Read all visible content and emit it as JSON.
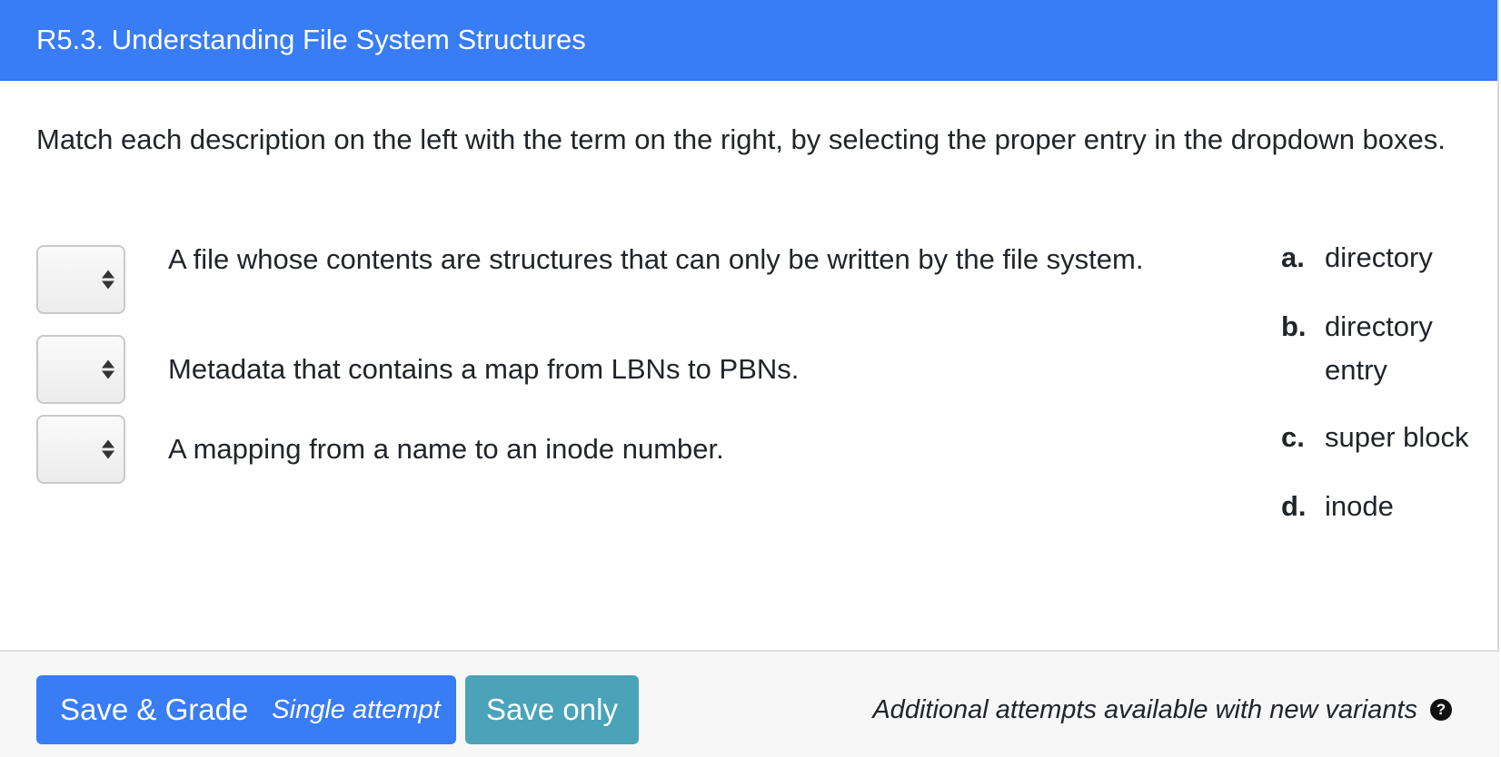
{
  "header": {
    "title": "R5.3. Understanding File System Structures"
  },
  "instructions": "Match each description on the left with the term on the right, by selecting the proper entry in the dropdown boxes.",
  "statements": [
    {
      "text": "A file whose contents are structures that can only be written by the file system.",
      "selected": ""
    },
    {
      "text": "Metadata that contains a map from LBNs to PBNs.",
      "selected": ""
    },
    {
      "text": "A mapping from a name to an inode number.",
      "selected": ""
    }
  ],
  "options": [
    {
      "letter": "a.",
      "text": "directory"
    },
    {
      "letter": "b.",
      "text": "directory entry"
    },
    {
      "letter": "c.",
      "text": "super block"
    },
    {
      "letter": "d.",
      "text": "inode"
    }
  ],
  "footer": {
    "grade_label": "Save & Grade",
    "grade_sub": "Single attempt",
    "save_label": "Save only",
    "note": "Additional attempts available with new variants",
    "help_glyph": "?"
  },
  "colors": {
    "header_bg": "#387cf6",
    "grade_btn": "#387cf6",
    "save_btn": "#4aa3b8",
    "footer_bg": "#f7f7f7"
  }
}
